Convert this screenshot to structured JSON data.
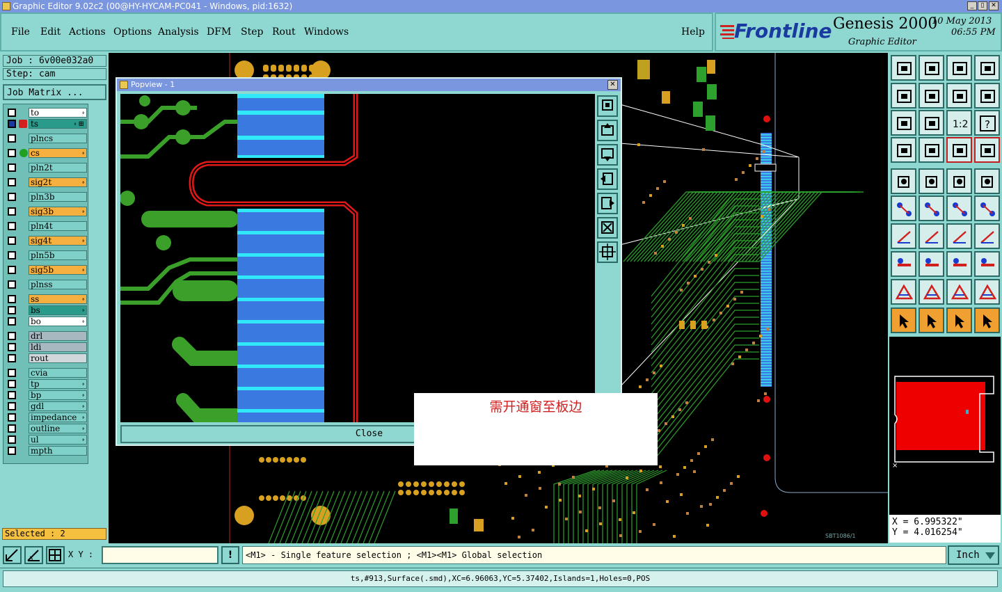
{
  "window": {
    "title": "Graphic Editor 9.02c2 (00@HY-HYCAM-PC041 - Windows, pid:1632)",
    "min": "_",
    "max": "▯",
    "close": "✕"
  },
  "menu": {
    "file": "File",
    "edit": "Edit",
    "actions": "Actions",
    "options": "Options",
    "analysis": "Analysis",
    "dfm": "DFM",
    "step": "Step",
    "rout": "Rout",
    "windows": "Windows",
    "help": "Help"
  },
  "brand": {
    "logo": "Frontline",
    "product": "Genesis 2000",
    "subtitle": "Graphic Editor",
    "date": "10 May 2013",
    "time": "06:55 PM"
  },
  "job": {
    "job": "Job : 6v00e032a0",
    "step": "Step: cam",
    "matrix": "Job Matrix ..."
  },
  "layers": [
    {
      "name": "to",
      "color": "#ffffff",
      "pen": "⬫",
      "mark": ""
    },
    {
      "name": "ts",
      "color": "#2a9a8a",
      "pen": "⬫ ⊞",
      "mark": "active"
    },
    {
      "name": "plncs",
      "color": "#7fd0c8",
      "pen": "",
      "mark": ""
    },
    {
      "name": "cs",
      "color": "#f5b040",
      "pen": "⬫",
      "mark": "green"
    },
    {
      "name": "pln2t",
      "color": "#7fd0c8",
      "pen": "",
      "mark": ""
    },
    {
      "name": "sig2t",
      "color": "#f5b040",
      "pen": "⬫",
      "mark": ""
    },
    {
      "name": "pln3b",
      "color": "#7fd0c8",
      "pen": "",
      "mark": ""
    },
    {
      "name": "sig3b",
      "color": "#f5b040",
      "pen": "⬫",
      "mark": ""
    },
    {
      "name": "pln4t",
      "color": "#7fd0c8",
      "pen": "",
      "mark": ""
    },
    {
      "name": "sig4t",
      "color": "#f5b040",
      "pen": "⬫",
      "mark": ""
    },
    {
      "name": "pln5b",
      "color": "#7fd0c8",
      "pen": "",
      "mark": ""
    },
    {
      "name": "sig5b",
      "color": "#f5b040",
      "pen": "⬫",
      "mark": ""
    },
    {
      "name": "plnss",
      "color": "#7fd0c8",
      "pen": "",
      "mark": ""
    },
    {
      "name": "ss",
      "color": "#f5b040",
      "pen": "⬫",
      "mark": ""
    },
    {
      "name": "bs",
      "color": "#2a9a8a",
      "pen": "⬫",
      "mark": ""
    },
    {
      "name": "bo",
      "color": "#ffffff",
      "pen": "⬫",
      "mark": ""
    },
    {
      "name": "drl",
      "color": "#a8b8c0",
      "pen": "",
      "mark": ""
    },
    {
      "name": "ldi",
      "color": "#a8b8c0",
      "pen": "",
      "mark": ""
    },
    {
      "name": "rout",
      "color": "#d0d8dc",
      "pen": "",
      "mark": ""
    },
    {
      "name": "cvia",
      "color": "#7fd0c8",
      "pen": "",
      "mark": ""
    },
    {
      "name": "tp",
      "color": "#7fd0c8",
      "pen": "⬫",
      "mark": ""
    },
    {
      "name": "bp",
      "color": "#7fd0c8",
      "pen": "⬫",
      "mark": ""
    },
    {
      "name": "gdl",
      "color": "#7fd0c8",
      "pen": "⬫",
      "mark": ""
    },
    {
      "name": "impedance",
      "color": "#7fd0c8",
      "pen": "⬫",
      "mark": ""
    },
    {
      "name": "outline",
      "color": "#7fd0c8",
      "pen": "⬫",
      "mark": ""
    },
    {
      "name": "ul",
      "color": "#7fd0c8",
      "pen": "⬫",
      "mark": ""
    },
    {
      "name": "mpth",
      "color": "#7fd0c8",
      "pen": "",
      "mark": ""
    }
  ],
  "popview": {
    "title": "Popview - 1",
    "close_x": "✕",
    "close_label": "Close"
  },
  "note": "需开通窗至板边",
  "canvas_label": "SBT1086/1",
  "selected": "Selected : 2",
  "coords": {
    "x": "X = 6.995322\"",
    "y": "Y = 4.016254\""
  },
  "status": {
    "xy_label": "X Y :",
    "bang": "!",
    "message": "<M1> - Single feature selection ; <M1><M1> Global selection",
    "unit": "Inch"
  },
  "info": "ts,#913,Surface(.smd),XC=6.96063,YC=5.37402,Islands=1,Holes=0,POS",
  "toolbuttons": {
    "r1c3": "",
    "ratio": "1:2",
    "help": "?"
  }
}
